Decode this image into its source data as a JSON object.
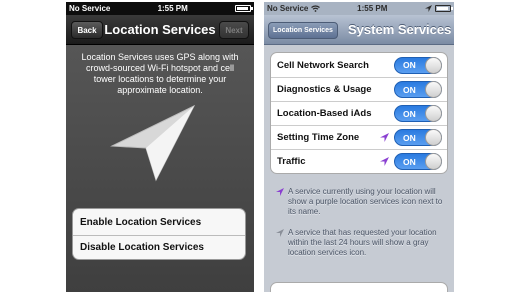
{
  "left_phone": {
    "status": {
      "carrier": "No Service",
      "time": "1:55 PM"
    },
    "nav": {
      "back": "Back",
      "title": "Location Services",
      "next": "Next"
    },
    "description": "Location Services uses GPS along with crowd-sourced Wi-Fi hotspot and cell tower locations to determine your approximate location.",
    "options": [
      "Enable Location Services",
      "Disable Location Services"
    ],
    "colors": {
      "background": "#4d4d4d",
      "navbar": "#222222"
    }
  },
  "right_phone": {
    "status": {
      "carrier": "No Service",
      "time": "1:55 PM"
    },
    "nav": {
      "back": "Location Services",
      "title": "System Services"
    },
    "rows": [
      {
        "label": "Cell Network Search",
        "state": "ON",
        "indicator": ""
      },
      {
        "label": "Diagnostics & Usage",
        "state": "ON",
        "indicator": ""
      },
      {
        "label": "Location-Based iAds",
        "state": "ON",
        "indicator": ""
      },
      {
        "label": "Setting Time Zone",
        "state": "ON",
        "indicator": "purple-location-arrow-icon"
      },
      {
        "label": "Traffic",
        "state": "ON",
        "indicator": "purple-location-arrow-icon"
      }
    ],
    "footnotes": [
      {
        "icon": "purple-location-arrow-icon",
        "text": "A service currently using your location will show a purple location services icon next to its name."
      },
      {
        "icon": "gray-location-arrow-icon",
        "text": "A service that has requested your location within the last 24 hours will show a gray location services icon."
      }
    ],
    "colors": {
      "toggle_on": "#2a7be0",
      "purple_icon": "#8a3fd1",
      "gray_icon": "#8a8f99",
      "navbar": "#8f9db4"
    }
  }
}
